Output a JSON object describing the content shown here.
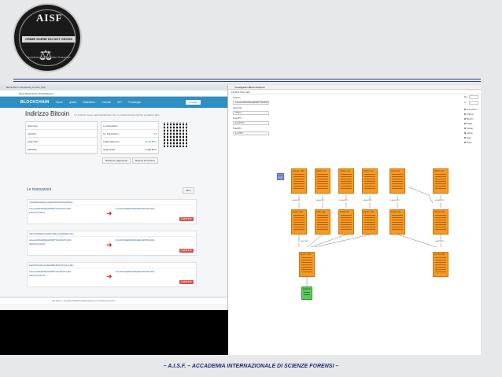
{
  "logo": {
    "title": "AISF",
    "band": "CRIME SCENE DO NOT CROSS",
    "ring_text": "Academy of Forensic Sciences"
  },
  "footer": {
    "text": "– A.I.S.F. – ACCADEMIA INTERNAZIONALE DI SCIENZE FORENSI –"
  },
  "browser": {
    "tab": "Blockchain Luxembourg S.A.R.L [US]",
    "url": "https://blockchain.info/it/address/...",
    "brand": "BLOCKCHAIN",
    "nav": [
      "Home",
      "grafici",
      "Statistiche",
      "mercati",
      "API",
      "Portafoglio"
    ],
    "signin": "ACCEDI",
    "heading": "Indirizzo Bitcoin",
    "heading_sub": "Un indirizzo serve degli identificativi che un privato fornisce bitcoin a qualcun altro",
    "summary_left": [
      "Summary",
      "Indirizzo",
      "Hash 160",
      "Etichetta"
    ],
    "summary_right": [
      "Le transazioni",
      "Nr. Transazioni",
      "Totale Ricevuto",
      "saldo finale"
    ],
    "summary_values": [
      "",
      "17",
      "40.44 BTC",
      "0.000 BTC"
    ],
    "buttons": [
      "Richiesto pagamento",
      "Bottone Donazioni"
    ],
    "transactions_title": "Le transazioni",
    "filter": "Filtro",
    "transactions": [
      {
        "hash": "7e8e9891ab9e3de7d3ebd00fa94f1b3f8e6a2...",
        "time": "2015-06-18 05:11",
        "amount": "0.0465 BTC"
      },
      {
        "hash": "d37cfcd3e58c2c4a4bd1c9dee1ca29da12c63...",
        "time": "2015-06-18 04:30",
        "amount": "0.0464 BTC"
      },
      {
        "hash": "aa0cbd0b7b2c4cd9e5a8813fa47c57c3e1d2b...",
        "time": "2015-06-18 04:15",
        "amount": "0.0464 BTC"
      }
    ],
    "tx_from": "1AeuwL9fAfu8JWq2sDhM8TYiNmW44YCy3N",
    "tx_to": "1Km6nbTwjkkRdXuBUxjEiUGWPsTkmF6q",
    "bottom": "Chi siamo | Contatti | Politica di Riservatezza | Termini di servizio"
  },
  "app": {
    "title": "Investigation Bitcoin Explorer",
    "menu": "File  Edit  View  Help",
    "labels": [
      "Address",
      "Hash 160",
      "Final BTC",
      "Total BTC"
    ],
    "fields": [
      "1AeuwL9fAfu8JWq2sDhM8TYiNmW44YCy3N",
      "d37cfc...",
      "40.44 BTC",
      "12.4 BTC"
    ],
    "from_label": "Da",
    "to_label": "A",
    "panel": [
      "Transazioni",
      "Indirizzi",
      "Blocchi",
      "Wallet",
      "Cluster",
      "Labels",
      "Tags",
      "Notes"
    ],
    "nodes": [
      "1AeuwL..Q9f",
      "1Hb3S..72k",
      "1Pq9a..m1X",
      "1MRnz..2xo",
      "1Fyh4..kTj",
      "1Bcdz..L4q",
      "1NqT2..9aP",
      "1Jr8v..7gQ",
      "1Kx9b..3Vz",
      "1Qd4L..pH6",
      "1Zp8x..Q1a",
      "1Dm3u..8kC",
      "1Lo2e..mN5",
      "1Gh7w..e2B"
    ],
    "green_node": "1Ax9..k3",
    "blue_node": "1C4..",
    "edge_labels": [
      "0.0465 BTC",
      "0.0465 BTC",
      "0.0464 BTC",
      "0.0464 BTC",
      "0.0464 BTC",
      "0.0465 BTC",
      "0.0465 BTC",
      "0.0465 BTC"
    ]
  }
}
